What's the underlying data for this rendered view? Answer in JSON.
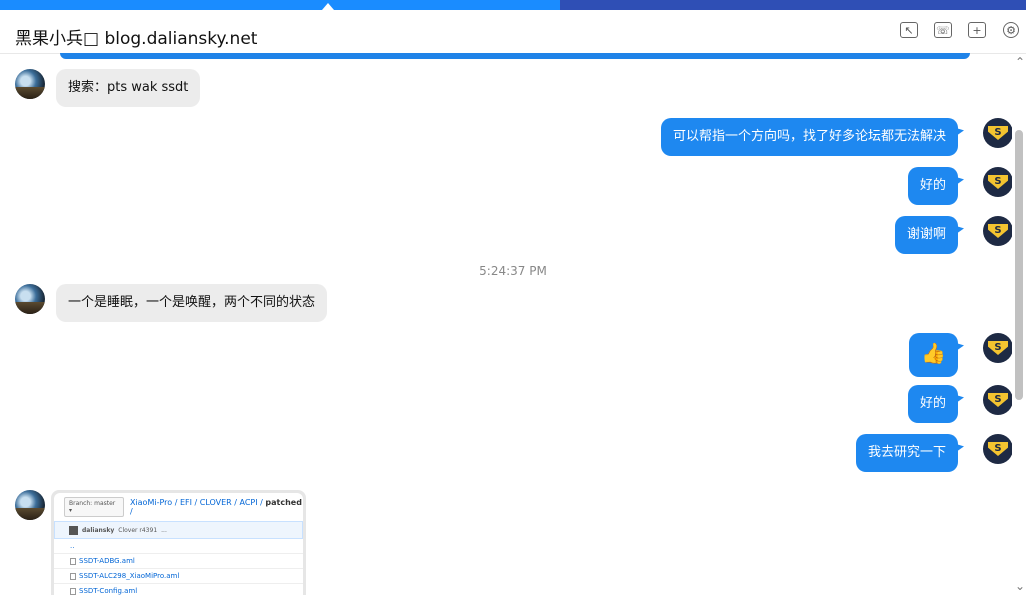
{
  "header": {
    "title": "黑果小兵□ blog.daliansky.net",
    "icons": [
      "screen-share-icon",
      "phone-icon",
      "add-icon",
      "settings-icon"
    ]
  },
  "messages": [
    {
      "side": "left",
      "text": "搜索：pts wak ssdt"
    },
    {
      "side": "right",
      "text": "可以帮指一个方向吗，找了好多论坛都无法解决"
    },
    {
      "side": "right",
      "text": "好的"
    },
    {
      "side": "right",
      "text": "谢谢啊"
    },
    {
      "type": "timestamp",
      "text": "5:24:37 PM"
    },
    {
      "side": "left",
      "text": "一个是睡眠，一个是唤醒，两个不同的状态"
    },
    {
      "side": "right",
      "text": "👍"
    },
    {
      "side": "right",
      "text": "好的"
    },
    {
      "side": "right",
      "text": "我去研究一下"
    }
  ],
  "image_card": {
    "branch": "Branch: master ▾",
    "path_repo": "XiaoMi-Pro",
    "path_rest": " / EFI / CLOVER / ACPI / ",
    "path_last": "patched",
    "path_end": " /",
    "commit_user": "daliansky",
    "commit_msg": "Clover r4391",
    "commit_extra": "...",
    "parent": "..",
    "files": [
      "SSDT-ADBG.aml",
      "SSDT-ALC298_XiaoMiPro.aml",
      "SSDT-Config.aml"
    ]
  },
  "colors": {
    "accent": "#1e88f0",
    "bubble_left": "#ececec",
    "top_strip": "#1a8cff",
    "top_strip_dark": "#2f4fb5"
  }
}
